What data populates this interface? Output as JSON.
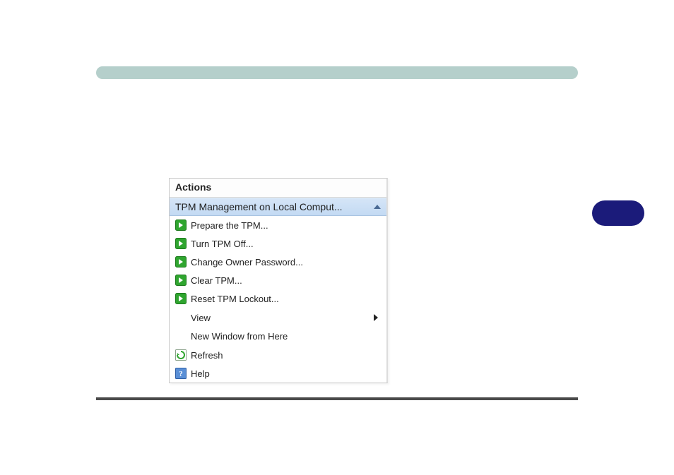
{
  "decorations": {
    "topBarColor": "#b5cfcb",
    "pillColor": "#1b1b7a",
    "bottomBarColor": "#4a4a4a"
  },
  "panel": {
    "title": "Actions",
    "section": {
      "label": "TPM Management on Local Comput..."
    },
    "items": [
      {
        "icon": "arrow",
        "label": "Prepare the TPM..."
      },
      {
        "icon": "arrow",
        "label": "Turn TPM Off..."
      },
      {
        "icon": "arrow",
        "label": "Change Owner Password..."
      },
      {
        "icon": "arrow",
        "label": "Clear TPM..."
      },
      {
        "icon": "arrow",
        "label": "Reset TPM Lockout..."
      },
      {
        "icon": "none",
        "label": "View",
        "submenu": true
      },
      {
        "icon": "none",
        "label": "New Window from Here"
      },
      {
        "icon": "refresh",
        "label": "Refresh"
      },
      {
        "icon": "help",
        "label": "Help"
      }
    ]
  }
}
